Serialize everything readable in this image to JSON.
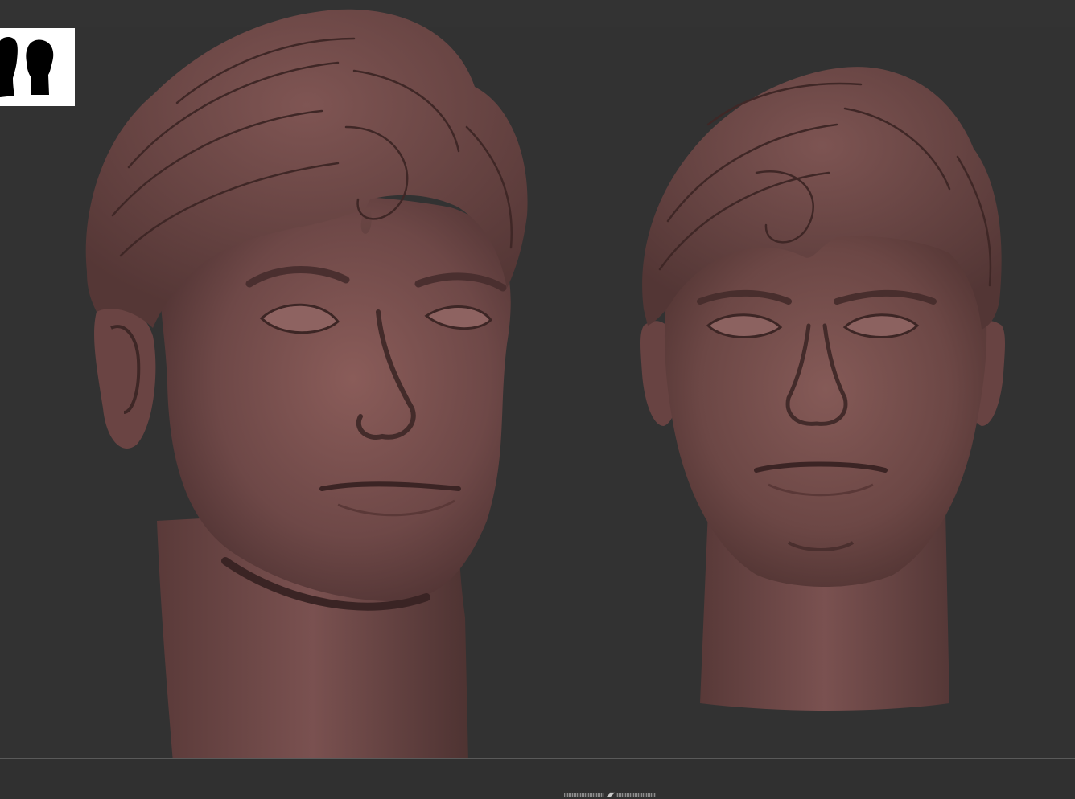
{
  "app": {
    "viewport_background": "#323232",
    "model_material_color": "#6e4847"
  },
  "navigator": {
    "icon": "head-silhouettes-navigator-icon"
  },
  "models": [
    {
      "icon": "sculpted-head-three-quarter-view"
    },
    {
      "icon": "sculpted-head-front-view"
    }
  ],
  "tray": {
    "icon": "tray-toggle-arrows-icon",
    "arrows": "◢◤"
  }
}
